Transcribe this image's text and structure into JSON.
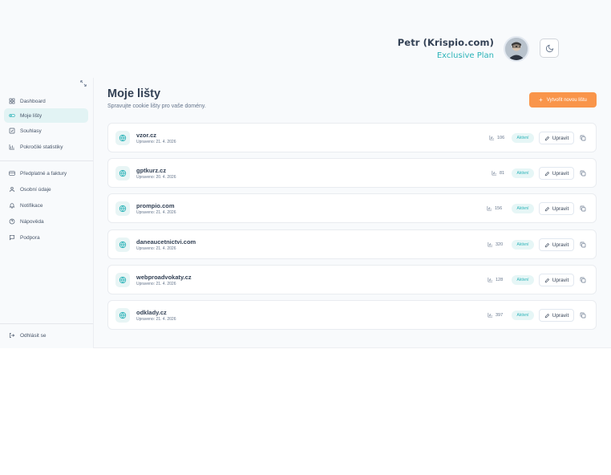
{
  "user": {
    "name": "Petr (Krispio.com)",
    "plan": "Exclusive Plan"
  },
  "sidebar": {
    "items": [
      {
        "label": "Dashboard",
        "icon": "grid-icon"
      },
      {
        "label": "Moje lišty",
        "icon": "toggle-icon",
        "active": true
      },
      {
        "label": "Souhlasy",
        "icon": "check-square-icon"
      },
      {
        "label": "Pokročilé statistiky",
        "icon": "bar-chart-icon"
      },
      {
        "label": "Předplatné a faktury",
        "icon": "credit-card-icon"
      },
      {
        "label": "Osobní údaje",
        "icon": "user-icon"
      },
      {
        "label": "Notifikace",
        "icon": "bell-icon"
      },
      {
        "label": "Nápověda",
        "icon": "help-circle-icon"
      },
      {
        "label": "Podpora",
        "icon": "message-icon"
      }
    ],
    "logout": "Odhlásit se"
  },
  "main": {
    "title": "Moje lišty",
    "subtitle": "Spravujte cookie lišty pro vaše domény.",
    "create_label": "Vytvořit novou lištu",
    "edit_label": "Upravit",
    "sites": [
      {
        "domain": "vzor.cz",
        "updated": "Upraveno: 21. 4. 2026",
        "count": "106",
        "status": "Aktivní"
      },
      {
        "domain": "gptkurz.cz",
        "updated": "Upraveno: 20. 4. 2026",
        "count": "81",
        "status": "Aktivní"
      },
      {
        "domain": "prompio.com",
        "updated": "Upraveno: 21. 4. 2026",
        "count": "156",
        "status": "Aktivní"
      },
      {
        "domain": "daneaucetnictvi.com",
        "updated": "Upraveno: 21. 4. 2026",
        "count": "320",
        "status": "Aktivní"
      },
      {
        "domain": "webproadvokaty.cz",
        "updated": "Upraveno: 21. 4. 2026",
        "count": "128",
        "status": "Aktivní"
      },
      {
        "domain": "odklady.cz",
        "updated": "Upraveno: 21. 4. 2026",
        "count": "397",
        "status": "Aktivní"
      }
    ]
  },
  "colors": {
    "accent": "#2bb3b8",
    "cta": "#f9954a",
    "active_bg": "#e2f3f4"
  }
}
